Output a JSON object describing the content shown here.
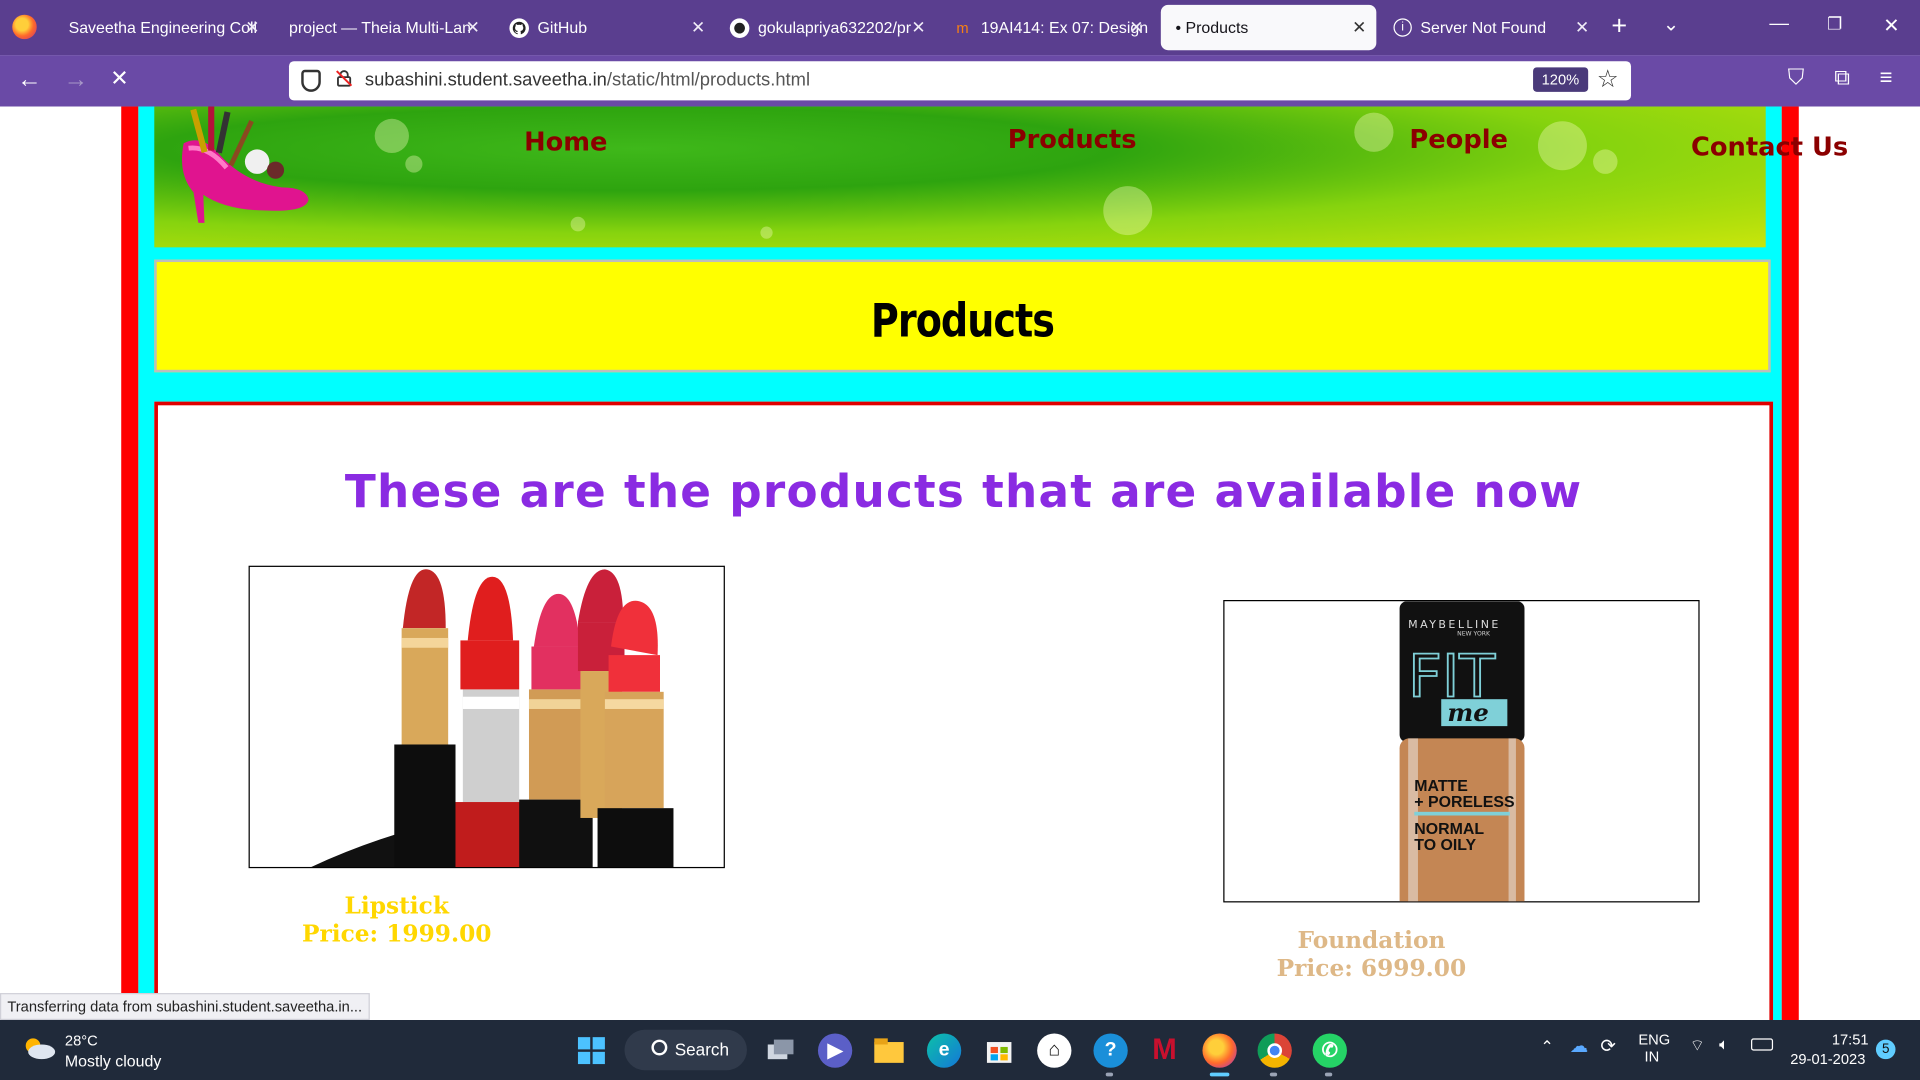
{
  "browser": {
    "tabs": [
      {
        "label": "Saveetha Engineering Coll",
        "icon": "document-icon"
      },
      {
        "label": "project — Theia Multi-Lan",
        "icon": "theia-icon"
      },
      {
        "label": "GitHub",
        "icon": "github-icon"
      },
      {
        "label": "gokulapriya632202/pr",
        "icon": "github-icon"
      },
      {
        "label": "19AI414: Ex 07: Design",
        "icon": "moodle-icon"
      },
      {
        "label": "• Products",
        "icon": "none",
        "active": true
      },
      {
        "label": "Server Not Found",
        "icon": "info-icon"
      }
    ],
    "url_host": "subashini.student.saveetha.in",
    "url_path": "/static/html/products.html",
    "zoom": "120%",
    "status": "Transferring data from subashini.student.saveetha.in..."
  },
  "site": {
    "nav": [
      "Home",
      "Products",
      "People",
      "Contact Us"
    ],
    "page_title": "Products",
    "headline": "These are the products that are available now",
    "products": [
      {
        "name": "Lipstick",
        "price": "Price: 1999.00",
        "color": "#ffd700"
      },
      {
        "name": "Foundation",
        "price": "Price: 6999.00",
        "color": "#deb887"
      }
    ],
    "foundation_label": {
      "brand": "MAYBELLINE",
      "sub": "NEW YORK",
      "fit": "FIT",
      "me": "me",
      "line1": "MATTE",
      "line2": "+ PORELESS",
      "line3": "NORMAL",
      "line4": "TO OILY"
    }
  },
  "taskbar": {
    "temp": "28°C",
    "weather": "Mostly cloudy",
    "search": "Search",
    "lang1": "ENG",
    "lang2": "IN",
    "time": "17:51",
    "date": "29-01-2023",
    "notifications": "5"
  },
  "colors": {
    "frame_red": "#ff0000",
    "frame_cyan": "#00ffff",
    "title_yellow": "#ffff00",
    "headline_purple": "#8a2be2",
    "nav_link": "#8b0000"
  }
}
